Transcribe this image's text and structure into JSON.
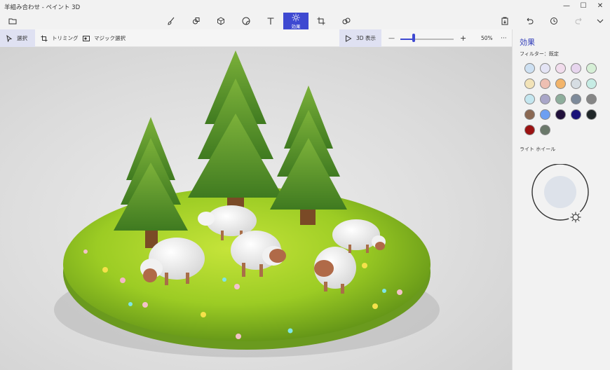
{
  "window": {
    "title": "羊組み合わせ - ペイント 3D",
    "minimize": "—",
    "maximize": "☐",
    "close": "✕"
  },
  "toolbar": {
    "tools": [
      {
        "name": "menu-folder",
        "icon": "folder-icon"
      },
      {
        "name": "brushes",
        "icon": "brush-icon"
      },
      {
        "name": "2d-shapes",
        "icon": "shapes-2d-icon"
      },
      {
        "name": "3d-shapes",
        "icon": "cube-icon"
      },
      {
        "name": "stickers",
        "icon": "sticker-icon"
      },
      {
        "name": "text",
        "icon": "text-icon"
      },
      {
        "name": "effects",
        "icon": "sun-icon",
        "label": "効果"
      },
      {
        "name": "canvas",
        "icon": "crop-icon"
      },
      {
        "name": "3d-library",
        "icon": "library-icon"
      }
    ],
    "actions": [
      "paste-icon",
      "undo-icon",
      "history-icon",
      "redo-icon",
      "chevron-down-icon"
    ],
    "active_color": "#3e49d1"
  },
  "subbar": {
    "select": "選択",
    "crop": "トリミング",
    "magic_select": "マジック選択",
    "view_3d": "3D 表示",
    "zoom_minus": "—",
    "zoom_plus": "+",
    "zoom_level": "50%",
    "more": "···",
    "zoom_fraction": 0.25
  },
  "panel": {
    "title": "効果",
    "filter_label": "フィルター：",
    "filter_value": "既定",
    "light_wheel_label": "ライト ホイール",
    "swatches": [
      "#cde0f2",
      "#e4e4f5",
      "#f1dcec",
      "#e7d5ee",
      "#d6efd6",
      "#f2e3b8",
      "#eebfb2",
      "#f2b46a",
      "#d6dde3",
      "#c6ece4",
      "#c4e6ef",
      "#a9a6c8",
      "#8eae9c",
      "#7d8a9a",
      "#868686",
      "#8a6852",
      "#6d9ff2",
      "#20103a",
      "#1a1278",
      "#1f2628",
      "#9b1212",
      "#6a786a"
    ]
  }
}
